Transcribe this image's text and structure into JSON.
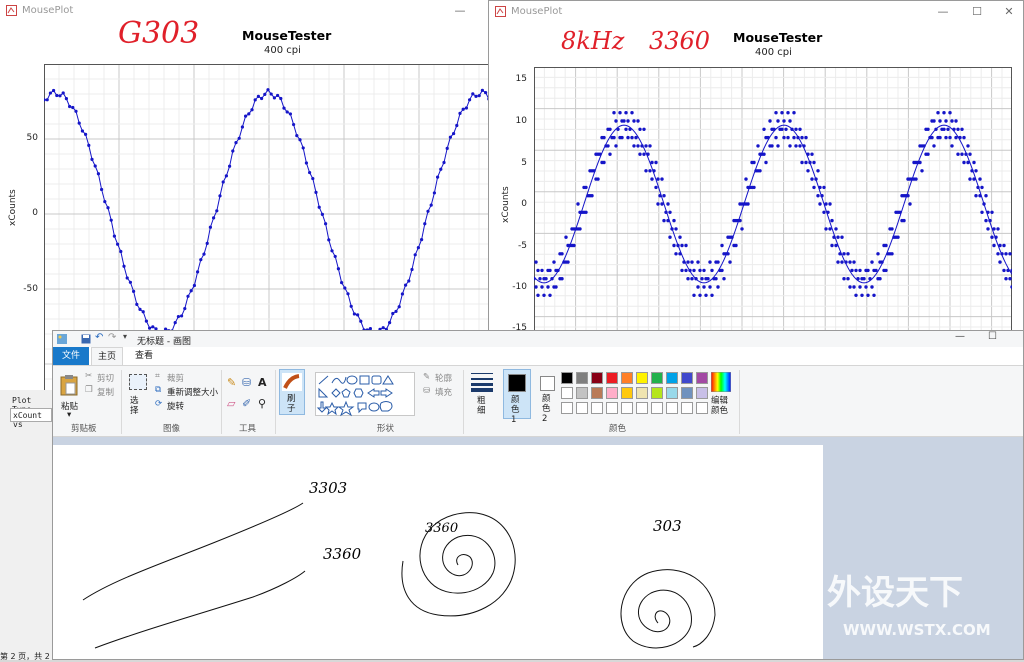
{
  "left_window": {
    "title": "MousePlot",
    "plot_title": "MouseTester",
    "plot_subtitle": "400 cpi",
    "ylabel": "xCounts",
    "yticks": [
      "50",
      "0",
      "-50"
    ],
    "handwritten": "G303"
  },
  "right_window": {
    "title": "MousePlot",
    "plot_title": "MouseTester",
    "plot_subtitle": "400 cpi",
    "ylabel": "xCounts",
    "yticks": [
      "15",
      "10",
      "5",
      "0",
      "-5",
      "-10",
      "-15"
    ],
    "handwritten_left": "8kHz",
    "handwritten_right": "3360",
    "controls": {
      "min": "—",
      "max": "☐",
      "close": "✕"
    }
  },
  "left_panel": {
    "plot_type_label": "Plot Type",
    "plot_type_value": "xCount vs",
    "page_status": "第 2 页，共 2"
  },
  "paint": {
    "window_title": "无标题 - 画图",
    "tabs": {
      "file": "文件",
      "home": "主页",
      "view": "查看"
    },
    "clipboard": {
      "paste": "粘贴",
      "cut": "剪切",
      "copy": "复制",
      "group": "剪贴板"
    },
    "image": {
      "select": "选择",
      "crop": "裁剪",
      "resize": "重新调整大小",
      "rotate": "旋转",
      "group": "图像"
    },
    "tools": {
      "group": "工具"
    },
    "brush": {
      "label": "刷子"
    },
    "shapes": {
      "outline": "轮廓",
      "fill": "填充",
      "group": "形状"
    },
    "size": {
      "label": "粗细"
    },
    "color1": "颜色 1",
    "color2": "颜色 2",
    "edit_colors": "编辑颜色",
    "colors_group": "颜色",
    "palette_row1": [
      "#000000",
      "#7f7f7f",
      "#880015",
      "#ed1c24",
      "#ff7f27",
      "#fff200",
      "#22b14c",
      "#00a2e8",
      "#3f48cc",
      "#a349a4"
    ],
    "palette_row2": [
      "#ffffff",
      "#c3c3c3",
      "#b97a57",
      "#ffaec9",
      "#ffc90e",
      "#efe4b0",
      "#b5e61d",
      "#99d9ea",
      "#7092be",
      "#c8bfe7"
    ],
    "drawings": {
      "label_303_top": "3303",
      "label_3360_line": "3360",
      "label_3360_spiral": "3360",
      "label_303_spiral": "303"
    }
  },
  "watermark": {
    "cn": "外设天下",
    "en": "WWW.WSTX.COM"
  },
  "colors": {
    "plot_blue": "#1515c8",
    "handwriting_red": "#e0202a",
    "accent_blue": "#1979ca"
  }
}
